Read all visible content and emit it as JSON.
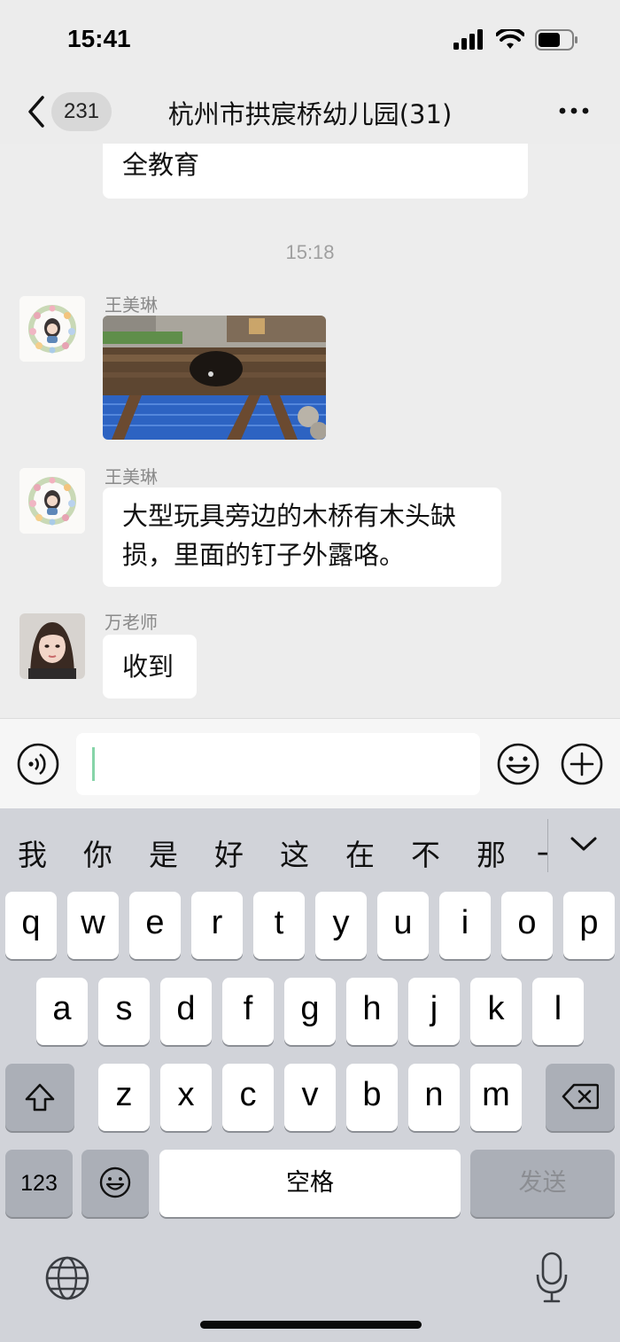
{
  "status_bar": {
    "time": "15:41"
  },
  "nav": {
    "back_count": "231",
    "title": "杭州市拱宸桥幼儿园(31)"
  },
  "messages": {
    "partial_bubble_text": "全教育",
    "timestamp": "15:18",
    "msg1": {
      "sender": "王美琳",
      "type": "image"
    },
    "msg2": {
      "sender": "王美琳",
      "line1": "大型玩具旁边的木桥有木头缺",
      "line2": "损，里面的钉子外露咯。"
    },
    "msg3": {
      "sender": "万老师",
      "text": "收到"
    }
  },
  "input": {
    "value": ""
  },
  "keyboard": {
    "candidates": [
      "我",
      "你",
      "是",
      "好",
      "这",
      "在",
      "不",
      "那",
      "一"
    ],
    "row1": [
      "q",
      "w",
      "e",
      "r",
      "t",
      "y",
      "u",
      "i",
      "o",
      "p"
    ],
    "row2": [
      "a",
      "s",
      "d",
      "f",
      "g",
      "h",
      "j",
      "k",
      "l"
    ],
    "row3": [
      "z",
      "x",
      "c",
      "v",
      "b",
      "n",
      "m"
    ],
    "numbers_label": "123",
    "space_label": "空格",
    "send_label": "发送"
  },
  "colors": {
    "chat_bg": "#ededed",
    "bubble_bg": "#ffffff",
    "keyboard_bg": "#d1d3d9",
    "dark_key": "#abafb7",
    "caret": "#86d4a8"
  }
}
